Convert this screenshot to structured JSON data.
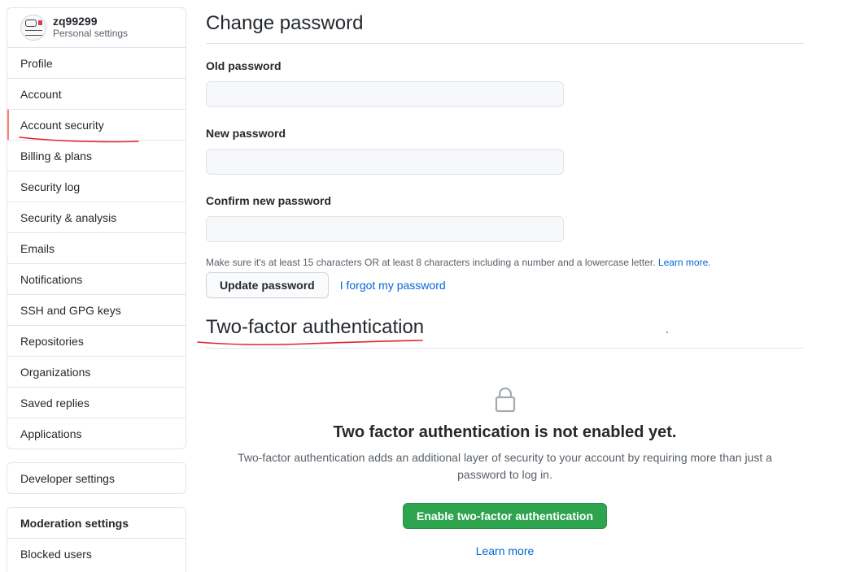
{
  "user": {
    "name": "zq99299",
    "subtitle": "Personal settings"
  },
  "sidebar": {
    "items": [
      {
        "label": "Profile"
      },
      {
        "label": "Account"
      },
      {
        "label": "Account security",
        "selected": true
      },
      {
        "label": "Billing & plans"
      },
      {
        "label": "Security log"
      },
      {
        "label": "Security & analysis"
      },
      {
        "label": "Emails"
      },
      {
        "label": "Notifications"
      },
      {
        "label": "SSH and GPG keys"
      },
      {
        "label": "Repositories"
      },
      {
        "label": "Organizations"
      },
      {
        "label": "Saved replies"
      },
      {
        "label": "Applications"
      }
    ],
    "developer_settings": "Developer settings",
    "moderation": {
      "heading": "Moderation settings",
      "items": [
        {
          "label": "Blocked users"
        }
      ]
    }
  },
  "change_password": {
    "title": "Change password",
    "old_label": "Old password",
    "new_label": "New password",
    "confirm_label": "Confirm new password",
    "note": "Make sure it's at least 15 characters OR at least 8 characters including a number and a lowercase letter.",
    "note_link": "Learn more.",
    "update_button": "Update password",
    "forgot_link": "I forgot my password"
  },
  "two_factor": {
    "title": "Two-factor authentication",
    "heading": "Two factor authentication is not enabled yet.",
    "description": "Two-factor authentication adds an additional layer of security to your account by requiring more than just a password to log in.",
    "enable_button": "Enable two-factor authentication",
    "learn_more": "Learn more",
    "icon": "lock-icon"
  },
  "colors": {
    "accent_selected": "#f9826c",
    "primary_button": "#2ea44f",
    "link": "#0366d6",
    "annotation": "#e0242b"
  }
}
